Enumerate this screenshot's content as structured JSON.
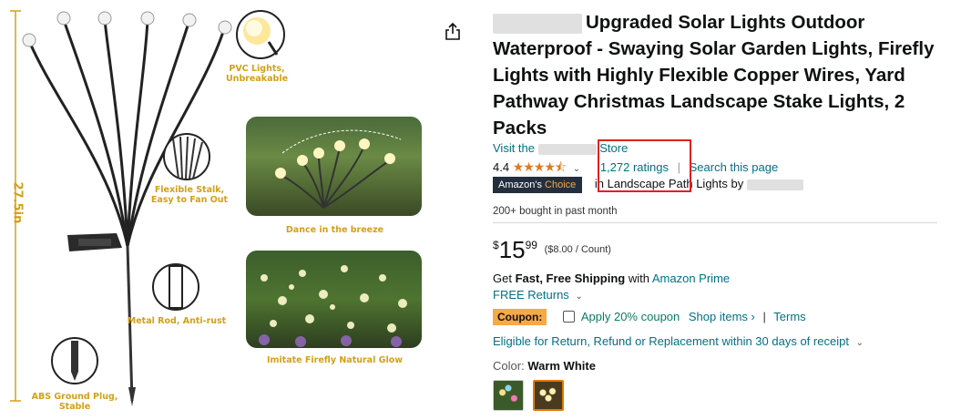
{
  "image": {
    "label_pvc": "PVC Lights, Unbreakable",
    "label_stalk": "Flexible Stalk, Easy to Fan Out",
    "label_rod": "Metal Rod, Anti-rust",
    "label_plug": "ABS Ground Plug, Stable",
    "label_dance": "Dance in the breeze",
    "label_firefly": "Imitate Firefly Natural Glow",
    "label_height": "27.5in"
  },
  "product": {
    "title": "Upgraded Solar Lights Outdoor Waterproof - Swaying Solar Garden Lights, Firefly Lights with Highly Flexible Copper Wires, Yard Pathway Christmas Landscape Stake Lights, 2 Packs",
    "store_prefix": "Visit the",
    "store_suffix": "Store",
    "rating_value": "4.4",
    "stars": "★★★★⯪",
    "ratings_count": "1,272 ratings",
    "search_page": "Search this page",
    "choice_amazons": "Amazon's",
    "choice_word": "Choice",
    "choice_category": "in Landscape Path Lights by",
    "bought": "200+ bought in past month",
    "price_symbol": "$",
    "price_whole": "15",
    "price_fraction": "99",
    "price_per": "($8.00 / Count)",
    "shipping_get": "Get",
    "shipping_fast": "Fast, Free Shipping",
    "shipping_with": "with",
    "shipping_prime": "Amazon Prime",
    "free_returns": "FREE Returns",
    "coupon_label": "Coupon:",
    "coupon_text": "Apply 20% coupon",
    "shop_items": "Shop items ›",
    "terms": "Terms",
    "eligible": "Eligible for Return, Refund or Replacement within 30 days of receipt",
    "color_label": "Color:",
    "color_value": "Warm White"
  },
  "colors": {
    "link": "#007185",
    "star": "#de7921",
    "highlight": "#e02020",
    "coupon": "#f7a847",
    "badge": "#232f3e"
  }
}
